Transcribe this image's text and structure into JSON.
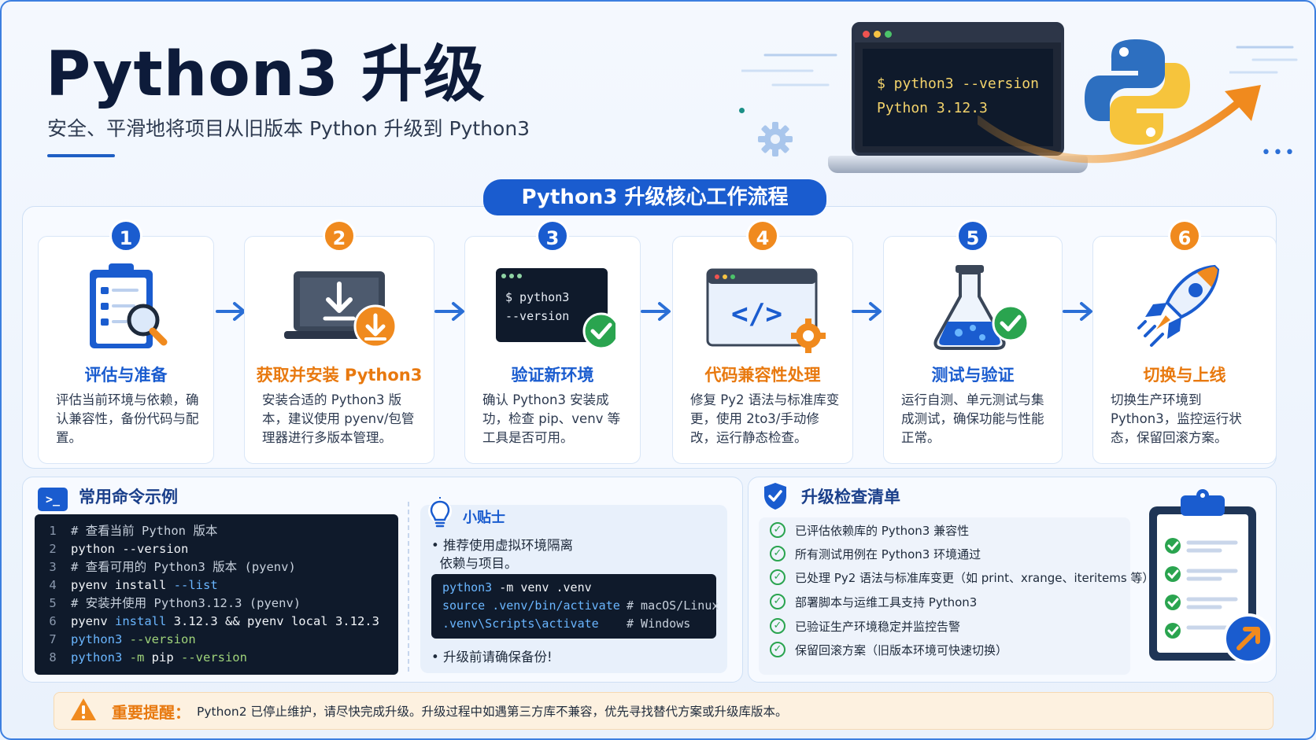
{
  "header": {
    "title": "Python3 升级",
    "subtitle": "安全、平滑地将项目从旧版本 Python 升级到 Python3"
  },
  "hero": {
    "terminal_line1": "$ python3 --version",
    "terminal_line2": "Python 3.12.3",
    "logo_icon": "python-logo-icon"
  },
  "workflow": {
    "title": "Python3 升级核心工作流程",
    "steps": [
      {
        "num": "1",
        "title": "评估与准备",
        "desc": "评估当前环境与依赖，确认兼容性，备份代码与配置。",
        "icon": "clipboard-magnifier-icon",
        "accent": "blue"
      },
      {
        "num": "2",
        "title": "获取并安装 Python3",
        "desc": "安装合适的 Python3 版本，建议使用 pyenv/包管理器进行多版本管理。",
        "icon": "laptop-download-icon",
        "accent": "orange"
      },
      {
        "num": "3",
        "title": "验证新环境",
        "desc": "确认 Python3 安装成功，检查 pip、venv 等工具是否可用。",
        "icon": "terminal-check-icon",
        "accent": "blue",
        "terminal": [
          "$ python3",
          "--version"
        ]
      },
      {
        "num": "4",
        "title": "代码兼容性处理",
        "desc": "修复 Py2 语法与标准库变更，使用 2to3/手动修改，运行静态检查。",
        "icon": "code-window-gear-icon",
        "accent": "orange",
        "code_glyph": "</>"
      },
      {
        "num": "5",
        "title": "测试与验证",
        "desc": "运行自测、单元测试与集成测试，确保功能与性能正常。",
        "icon": "flask-check-icon",
        "accent": "blue"
      },
      {
        "num": "6",
        "title": "切换与上线",
        "desc": "切换生产环境到 Python3，监控运行状态，保留回滚方案。",
        "icon": "rocket-icon",
        "accent": "orange"
      }
    ]
  },
  "commands": {
    "title": "常用命令示例",
    "icon_glyph": ">_",
    "lines": [
      {
        "n": "1",
        "segments": [
          {
            "t": "# 查看当前 Python 版本",
            "c": "c-comment"
          }
        ]
      },
      {
        "n": "2",
        "segments": [
          {
            "t": "python --version",
            "c": "c-plain"
          }
        ]
      },
      {
        "n": "3",
        "segments": [
          {
            "t": "# 查看可用的 Python3 版本 (pyenv)",
            "c": "c-comment"
          }
        ]
      },
      {
        "n": "4",
        "segments": [
          {
            "t": "pyenv install ",
            "c": "c-plain"
          },
          {
            "t": "--list",
            "c": "c-kw"
          }
        ]
      },
      {
        "n": "5",
        "segments": [
          {
            "t": "# 安装并使用 Python3.12.3 (pyenv)",
            "c": "c-comment"
          }
        ]
      },
      {
        "n": "6",
        "segments": [
          {
            "t": "pyenv ",
            "c": "c-plain"
          },
          {
            "t": "install",
            "c": "c-kw"
          },
          {
            "t": " 3.12.3 && pyenv local 3.12.3",
            "c": "c-plain"
          }
        ]
      },
      {
        "n": "7",
        "segments": [
          {
            "t": "python3",
            "c": "c-kw"
          },
          {
            "t": " --version",
            "c": "c-str"
          }
        ]
      },
      {
        "n": "8",
        "segments": [
          {
            "t": "python3",
            "c": "c-kw"
          },
          {
            "t": " -m ",
            "c": "c-str"
          },
          {
            "t": "pip",
            "c": "c-plain"
          },
          {
            "t": " --version",
            "c": "c-str"
          }
        ]
      }
    ]
  },
  "tip": {
    "title": "小贴士",
    "bullet1_line1": "• 推荐使用虚拟环境隔离",
    "bullet1_line2": "  依赖与项目。",
    "code": [
      {
        "cmd_kw": "python3",
        "cmd_rest": " -m venv .venv",
        "comment": ""
      },
      {
        "cmd_kw": "source",
        "cmd_rest": " .venv/bin/activate",
        "comment": "# macOS/Linux"
      },
      {
        "cmd_kw": "",
        "cmd_rest": ".venv\\Scripts\\activate",
        "comment": "# Windows"
      }
    ],
    "bullet2": "• 升级前请确保备份!"
  },
  "checklist": {
    "title": "升级检查清单",
    "items": [
      "已评估依赖库的 Python3 兼容性",
      "所有测试用例在 Python3 环境通过",
      "已处理 Py2 语法与标准库变更（如 print、xrange、iteritems 等）",
      "部署脚本与运维工具支持 Python3",
      "已验证生产环境稳定并监控告警",
      "保留回滚方案（旧版本环境可快速切换）"
    ]
  },
  "warning": {
    "label": "重要提醒：",
    "text": "Python2 已停止维护，请尽快完成升级。升级过程中如遇第三方库不兼容，优先寻找替代方案或升级库版本。"
  },
  "colors": {
    "primary_blue": "#1a5ccf",
    "accent_orange": "#f08a1e",
    "check_green": "#2aa44f",
    "terminal_bg": "#0f1a2b"
  }
}
